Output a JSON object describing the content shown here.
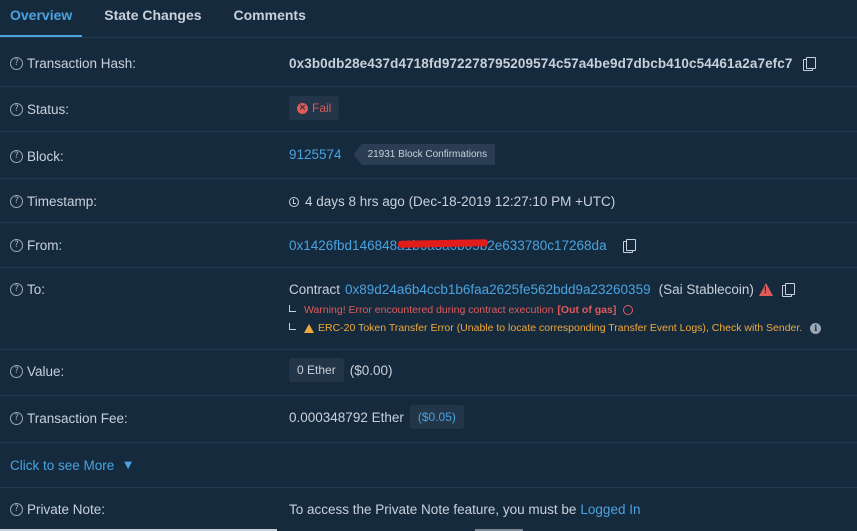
{
  "tabs": [
    {
      "label": "Overview",
      "active": true
    },
    {
      "label": "State Changes",
      "active": false
    },
    {
      "label": "Comments",
      "active": false
    }
  ],
  "rows": {
    "tx_hash": {
      "label": "Transaction Hash:",
      "value": "0x3b0db28e437d4718fd972278795209574c57a4be9d7dbcb410c54461a2a7efc7"
    },
    "status": {
      "label": "Status:",
      "value": "Fail"
    },
    "block": {
      "label": "Block:",
      "value": "9125574",
      "confirmations": "21931 Block Confirmations"
    },
    "timestamp": {
      "label": "Timestamp:",
      "value": "4 days 8 hrs ago (Dec-18-2019 12:27:10 PM +UTC)"
    },
    "from": {
      "label": "From:",
      "value": "0x1426fbd146848a1b6a3a0b05b2e633780c17268da"
    },
    "to": {
      "label": "To:",
      "prefix": "Contract",
      "value": "0x89d24a6b4ccb1b6faa2625fe562bdd9a23260359",
      "name": "(Sai Stablecoin)",
      "warning1": "Warning! Error encountered during contract execution",
      "warning1_bracket": "[Out of gas]",
      "warning2": "ERC-20 Token Transfer Error (Unable to locate corresponding Transfer Event Logs), Check with Sender."
    },
    "value": {
      "label": "Value:",
      "amount": "0 Ether",
      "usd": "($0.00)"
    },
    "fee": {
      "label": "Transaction Fee:",
      "amount": "0.000348792 Ether",
      "usd": "($0.05)"
    },
    "private_note": {
      "label": "Private Note:",
      "text": "To access the Private Note feature, you must be",
      "link": "Logged In"
    }
  },
  "click_more": "Click to see More",
  "colors": {
    "background": "#162a3e",
    "link": "#4aa3df",
    "error": "#e05a5a",
    "warning": "#f0a93b"
  }
}
